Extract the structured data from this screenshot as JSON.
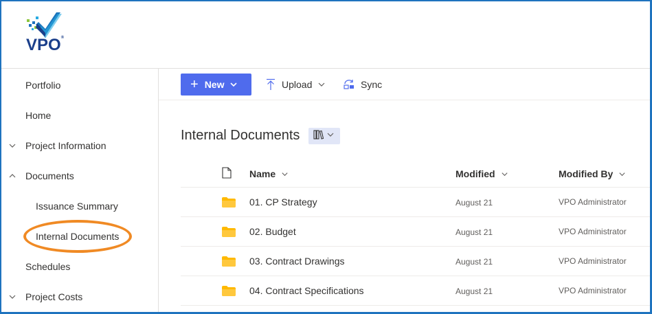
{
  "brand": {
    "name": "VPO",
    "tm": "®"
  },
  "sidebar": {
    "items": [
      {
        "label": "Portfolio",
        "chevron": ""
      },
      {
        "label": "Home",
        "chevron": ""
      },
      {
        "label": "Project Information",
        "chevron": "chevron-down"
      },
      {
        "label": "Documents",
        "chevron": "chevron-up"
      },
      {
        "label": "Issuance Summary",
        "chevron": ""
      },
      {
        "label": "Internal Documents",
        "chevron": ""
      },
      {
        "label": "Schedules",
        "chevron": ""
      },
      {
        "label": "Project Costs",
        "chevron": "chevron-down"
      }
    ]
  },
  "commandbar": {
    "new_label": "New",
    "upload_label": "Upload",
    "sync_label": "Sync"
  },
  "library": {
    "title": "Internal Documents",
    "view_icon": "library-view-icon"
  },
  "columns": {
    "type_icon": "file-type-icon",
    "name": "Name",
    "modified": "Modified",
    "modified_by": "Modified By"
  },
  "rows": [
    {
      "name": "01. CP Strategy",
      "modified": "August 21",
      "modified_by": "VPO Administrator"
    },
    {
      "name": "02. Budget",
      "modified": "August 21",
      "modified_by": "VPO Administrator"
    },
    {
      "name": "03. Contract Drawings",
      "modified": "August 21",
      "modified_by": "VPO Administrator"
    },
    {
      "name": "04. Contract Specifications",
      "modified": "August 21",
      "modified_by": "VPO Administrator"
    }
  ],
  "colors": {
    "accent": "#4f6bed",
    "brand": "#1b3f8b",
    "highlight": "#f08a24",
    "folder": "#ffb900",
    "frame": "#1e73be"
  }
}
